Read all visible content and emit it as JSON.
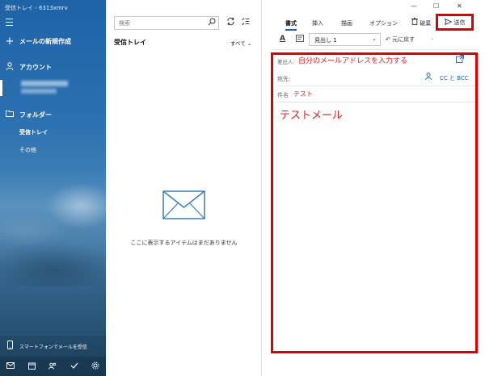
{
  "nav": {
    "window_title": "受信トレイ - 6313xmrv",
    "new_mail_label": "メールの新規作成",
    "accounts_label": "アカウント",
    "folders_label": "フォルダー",
    "folder_items": [
      {
        "label": "受信トレイ"
      },
      {
        "label": "その他"
      }
    ],
    "phone_label": "スマートフォンでメールを受信",
    "bottom_icons": [
      "mail-icon",
      "calendar-icon",
      "people-icon",
      "todo-icon",
      "settings-icon"
    ]
  },
  "list": {
    "search_placeholder": "検索",
    "folder_title": "受信トレイ",
    "filter_label": "すべて ⌄",
    "empty_message": "ここに表示するアイテムはまだありません"
  },
  "compose": {
    "tabs": [
      "書式",
      "挿入",
      "描画",
      "オプション"
    ],
    "active_tab": "書式",
    "discard_label": "破棄",
    "send_label": "送信",
    "heading_style": "見出し 1",
    "undo_label": "元に戻す",
    "from_label": "差出人:",
    "from_value": "自分のメールアドレスを入力する",
    "to_label": "宛先:",
    "to_value": "",
    "cc_bcc_label": "CC と BCC",
    "subject_label": "件名",
    "subject_value": "テスト",
    "body": "テストメール"
  },
  "colors": {
    "accent": "#1f5fa8",
    "highlight_frame": "#e00000",
    "annotation_text": "#e02020"
  }
}
